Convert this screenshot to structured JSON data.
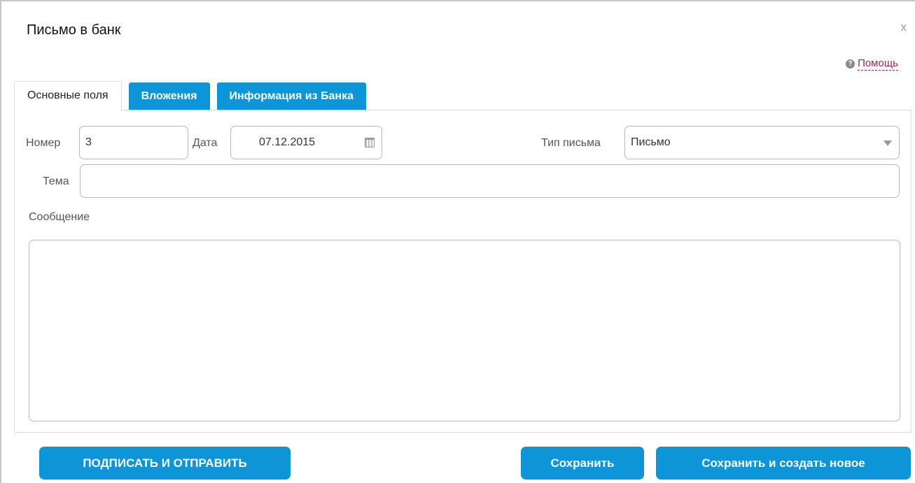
{
  "dialog": {
    "title": "Письмо в банк",
    "close_glyph": "x",
    "help_label": "Помощь",
    "help_icon": "question-circle-icon"
  },
  "tabs": [
    {
      "label": "Основные поля",
      "active": true
    },
    {
      "label": "Вложения",
      "active": false
    },
    {
      "label": "Информация из Банка",
      "active": false
    }
  ],
  "form": {
    "number_label": "Номер",
    "number_value": "3",
    "date_label": "Дата",
    "date_value": "07.12.2015",
    "letter_type_label": "Тип письма",
    "letter_type_value": "Письмо",
    "subject_label": "Тема",
    "subject_value": "",
    "message_label": "Сообщение",
    "message_value": ""
  },
  "buttons": {
    "sign_send": "ПОДПИСАТЬ И ОТПРАВИТЬ",
    "save": "Сохранить",
    "save_new": "Сохранить и создать новое"
  },
  "colors": {
    "accent": "#0e95d8",
    "help_link": "#a0255a"
  }
}
